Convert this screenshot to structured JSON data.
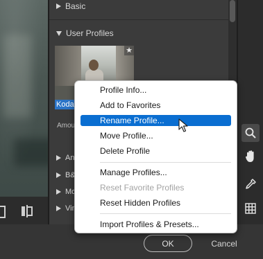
{
  "panel": {
    "basic_label": "Basic",
    "user_profiles_label": "User Profiles",
    "profile_thumbnail": {
      "label": "Kodac",
      "star": "★"
    },
    "amount_label": "Amou",
    "collapsed_rows": [
      "An",
      "B&",
      "Mo",
      "Vin"
    ]
  },
  "context_menu": {
    "items": [
      {
        "label": "Profile Info...",
        "state": "normal"
      },
      {
        "label": "Add to Favorites",
        "state": "normal"
      },
      {
        "label": "Rename Profile...",
        "state": "selected"
      },
      {
        "label": "Move Profile...",
        "state": "normal"
      },
      {
        "label": "Delete Profile",
        "state": "normal"
      },
      {
        "label": "Manage Profiles...",
        "state": "normal"
      },
      {
        "label": "Reset Favorite Profiles",
        "state": "disabled"
      },
      {
        "label": "Reset Hidden Profiles",
        "state": "normal"
      },
      {
        "label": "Import Profiles & Presets...",
        "state": "normal"
      }
    ]
  },
  "dialog": {
    "ok_label": "OK",
    "cancel_label": "Cancel"
  },
  "tools": [
    "zoom-icon",
    "hand-icon",
    "eyedropper-icon",
    "grid-icon"
  ],
  "colors": {
    "selection": "#0a6ed1",
    "thumbnail_label_bg": "#2b74c7"
  }
}
